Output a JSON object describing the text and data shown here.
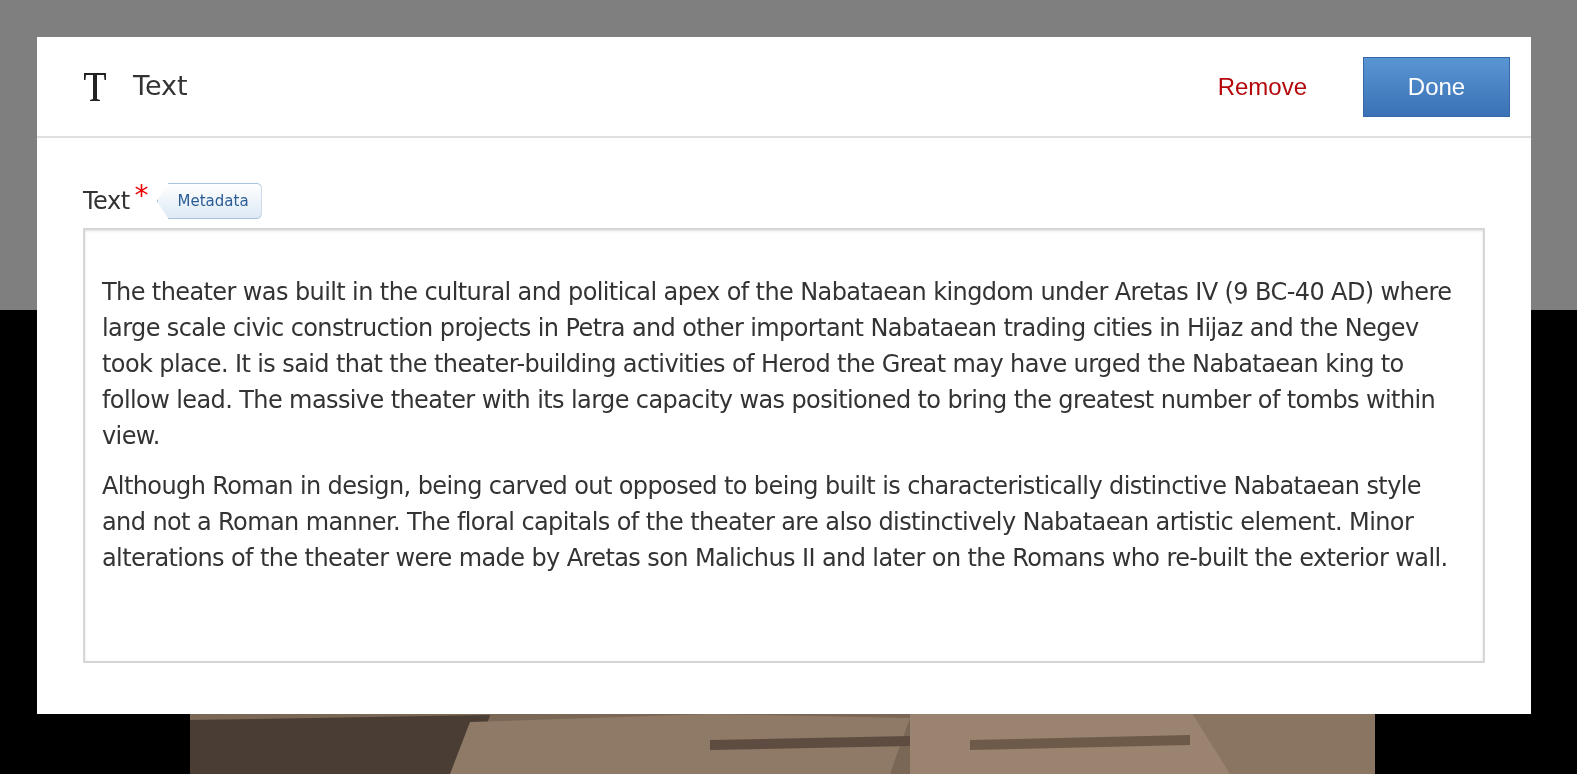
{
  "dialog": {
    "title": "Text",
    "remove_label": "Remove",
    "done_label": "Done"
  },
  "field": {
    "label": "Text",
    "required": true,
    "required_mark": "*",
    "tag": "Metadata",
    "paragraphs": [
      "The theater was built in the cultural and political apex of the Nabataean kingdom under Aretas IV (9 BC-40 AD) where large scale civic construction projects in Petra and other important Nabataean trading cities in Hijaz and the Negev took place. It is said that the theater-building activities of Herod the Great may have urged the Nabataean king to follow lead. The massive theater with its large capacity was positioned to bring the greatest number of tombs within view.",
      "Although Roman in design, being carved out opposed to being built is characteristically distinctive Nabataean style and not a Roman manner. The floral capitals of the theater are also distinctively Nabataean artistic element. Minor alterations of the theater were made by Aretas son Malichus II and later on the Romans who re-built the exterior wall."
    ]
  }
}
